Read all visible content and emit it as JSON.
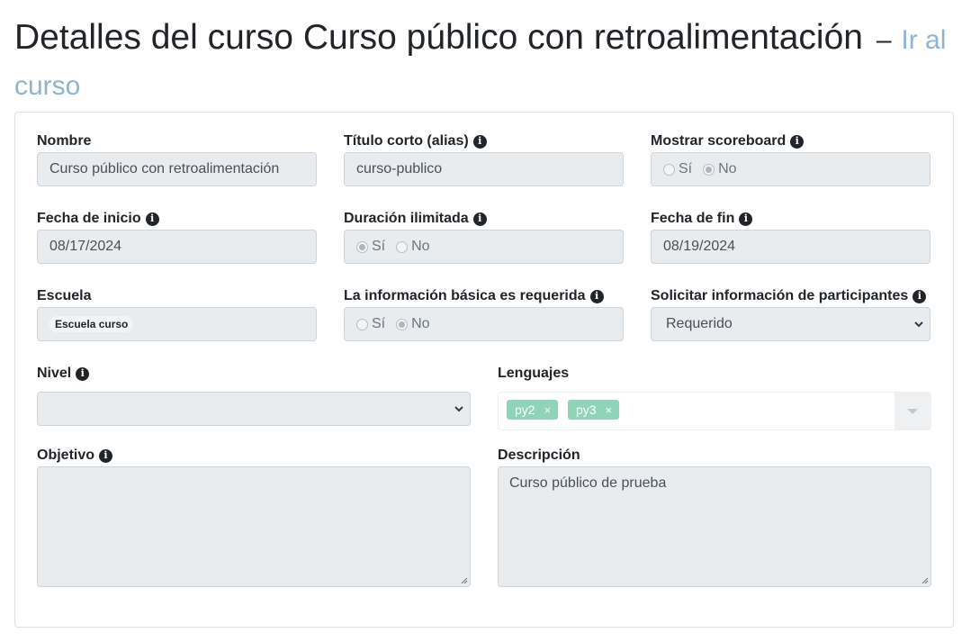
{
  "header": {
    "title": "Detalles del curso Curso público con retroalimentación",
    "separator": "–",
    "link": "Ir al curso"
  },
  "form": {
    "name": {
      "label": "Nombre",
      "value": "Curso público con retroalimentación"
    },
    "alias": {
      "label": "Título corto (alias)",
      "value": "curso-publico"
    },
    "scoreboard": {
      "label": "Mostrar scoreboard",
      "yes": "Sí",
      "no": "No",
      "selected": "No"
    },
    "start_date": {
      "label": "Fecha de inicio",
      "value": "08/17/2024"
    },
    "unlimited": {
      "label": "Duración ilimitada",
      "yes": "Sí",
      "no": "No",
      "selected": "Sí"
    },
    "end_date": {
      "label": "Fecha de fin",
      "value": "08/19/2024"
    },
    "school": {
      "label": "Escuela",
      "value": "Escuela curso"
    },
    "basic_info": {
      "label": "La información básica es requerida",
      "yes": "Sí",
      "no": "No",
      "selected": "No"
    },
    "participant_info": {
      "label": "Solicitar información de participantes",
      "value": "Requerido"
    },
    "level": {
      "label": "Nivel",
      "value": ""
    },
    "languages": {
      "label": "Lenguajes",
      "tags": [
        "py2",
        "py3"
      ],
      "remove": "×"
    },
    "objective": {
      "label": "Objetivo",
      "value": ""
    },
    "description": {
      "label": "Descripción",
      "value": "Curso público de prueba"
    }
  },
  "icons": {
    "info": "info-circle-icon",
    "select": "chevron-down-icon",
    "tag_remove": "close-icon"
  },
  "colors": {
    "link": "#8fb3d2",
    "tag": "#8fd4b8",
    "disabled_field": "#e9ecef"
  }
}
